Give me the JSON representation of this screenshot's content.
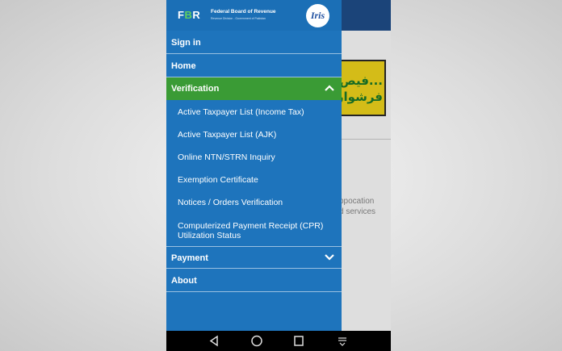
{
  "background": {
    "banner_text": "...فیص\nفرشوار",
    "text": "ppocation\nd services"
  },
  "header": {
    "logo_text_left": "F",
    "logo_text_accent": "B",
    "logo_text_right": "R",
    "title": "Federal Board of Revenue",
    "subtitle": "Revenue Division - Government of Pakistan",
    "iris_logo": "Iris"
  },
  "menu": {
    "sign_in": "Sign in",
    "home": "Home",
    "verification": "Verification",
    "payment": "Payment",
    "about": "About"
  },
  "verification_items": [
    "Active Taxpayer List (Income Tax)",
    "Active Taxpayer List (AJK)",
    "Online NTN/STRN Inquiry",
    "Exemption Certificate",
    "Notices / Orders Verification",
    "Computerized Payment Receipt (CPR)",
    "Utilization Status"
  ],
  "icons": {
    "verification_chevron": "chevron-up-icon",
    "payment_chevron": "chevron-down-icon"
  },
  "colors": {
    "drawer_bg": "#1e74bc",
    "active_bg": "#3a9b35",
    "banner_bg": "#f2d71c"
  }
}
